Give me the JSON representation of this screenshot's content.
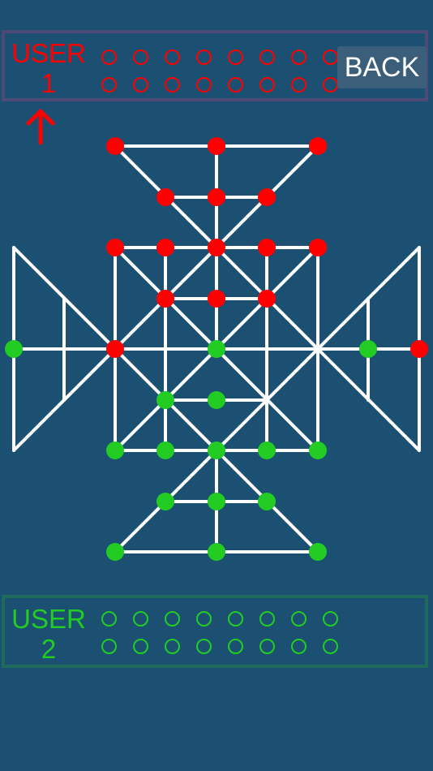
{
  "colors": {
    "background": "#1b5072",
    "player1": "#ff0000",
    "player2": "#22cc22",
    "lines": "#ffffff",
    "back_button_bg": "#3b5f7a"
  },
  "player1": {
    "label_line1": "USER",
    "label_line2": "1",
    "reserve_counters": 16,
    "active_turn": true
  },
  "player2": {
    "label_line1": "USER",
    "label_line2": "2",
    "reserve_counters": 16
  },
  "back_button": {
    "label": "BACK"
  },
  "board": {
    "red_positions": [
      "t1",
      "t2",
      "t3",
      "t4",
      "t5",
      "t6",
      "r1",
      "r2",
      "r3",
      "r4",
      "r5",
      "ma",
      "mb",
      "ml3",
      "mc",
      "rr3"
    ],
    "green_positions": [
      "ll3",
      "cc",
      "b1",
      "b2",
      "b3",
      "b4",
      "b5",
      "p1",
      "p2",
      "p3",
      "q1",
      "q2",
      "q3",
      "w1",
      "w2",
      "rr2"
    ]
  }
}
